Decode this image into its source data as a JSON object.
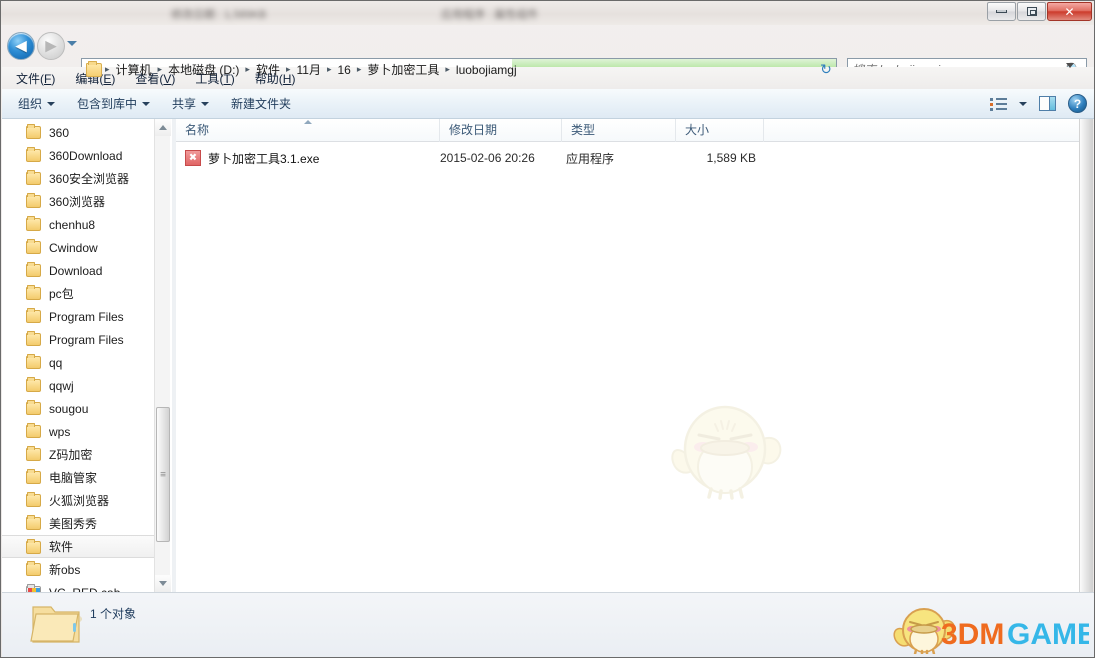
{
  "window": {
    "title_blur_left": "修改日期 : 1,589KB",
    "title_blur_right": "应用程序 : 属性组件",
    "controls": {
      "minimize": "—",
      "restore": "❐",
      "close": "✕"
    }
  },
  "nav": {
    "back_label": "◀",
    "forward_label": "▶",
    "history_label": "▼",
    "refresh_label": "↻"
  },
  "address": {
    "crumbs": [
      "计算机",
      "本地磁盘 (D:)",
      "软件",
      "11月",
      "16",
      "萝卜加密工具",
      "luobojiamgj"
    ],
    "separator": "▸",
    "progress_percent": 43
  },
  "search": {
    "placeholder": "搜索 luobojiamgj",
    "value": "",
    "icon": "search-icon"
  },
  "menu": {
    "items": [
      {
        "text": "文件",
        "key": "F"
      },
      {
        "text": "编辑",
        "key": "E"
      },
      {
        "text": "查看",
        "key": "V"
      },
      {
        "text": "工具",
        "key": "T"
      },
      {
        "text": "帮助",
        "key": "H"
      }
    ]
  },
  "toolbar": {
    "organize": "组织",
    "include_in_library": "包含到库中",
    "share": "共享",
    "new_folder": "新建文件夹",
    "help_glyph": "?"
  },
  "sidebar": {
    "items": [
      {
        "label": "360",
        "type": "folder",
        "selected": false
      },
      {
        "label": "360Download",
        "type": "folder",
        "selected": false
      },
      {
        "label": "360安全浏览器",
        "type": "folder",
        "selected": false
      },
      {
        "label": "360浏览器",
        "type": "folder",
        "selected": false
      },
      {
        "label": "chenhu8",
        "type": "folder",
        "selected": false
      },
      {
        "label": "Cwindow",
        "type": "folder",
        "selected": false
      },
      {
        "label": "Download",
        "type": "folder",
        "selected": false
      },
      {
        "label": "pc包",
        "type": "folder",
        "selected": false
      },
      {
        "label": "Program Files",
        "type": "folder",
        "selected": false
      },
      {
        "label": "Program Files",
        "type": "folder",
        "selected": false
      },
      {
        "label": "qq",
        "type": "folder",
        "selected": false
      },
      {
        "label": "qqwj",
        "type": "folder",
        "selected": false
      },
      {
        "label": "sougou",
        "type": "folder",
        "selected": false
      },
      {
        "label": "wps",
        "type": "folder",
        "selected": false
      },
      {
        "label": "Z码加密",
        "type": "folder",
        "selected": false
      },
      {
        "label": "电脑管家",
        "type": "folder",
        "selected": false
      },
      {
        "label": "火狐浏览器",
        "type": "folder",
        "selected": false
      },
      {
        "label": "美图秀秀",
        "type": "folder",
        "selected": false
      },
      {
        "label": "软件",
        "type": "folder",
        "selected": true
      },
      {
        "label": "新obs",
        "type": "folder",
        "selected": false
      },
      {
        "label": "VC_RED.cab",
        "type": "cab",
        "selected": false
      }
    ]
  },
  "filelist": {
    "columns": [
      "名称",
      "修改日期",
      "类型",
      "大小"
    ],
    "sort_column": "名称",
    "sort_direction": "asc",
    "rows": [
      {
        "name": "萝卜加密工具3.1.exe",
        "modified": "2015-02-06 20:26",
        "type": "应用程序",
        "size": "1,589 KB",
        "icon": "exe-icon"
      }
    ]
  },
  "status": {
    "text": "1 个对象",
    "icon": "folder-icon"
  },
  "watermark": {
    "brand_part1": "3DM",
    "brand_part2": "GAME",
    "color1": "#ef6b1f",
    "color2": "#35b7e8",
    "mascot": "bird-mascot"
  },
  "colors": {
    "accent": "#2f7fbd",
    "close_red": "#cc3b2c",
    "progress_green": "#7fd060",
    "folder_yellow": "#f3cb6c"
  }
}
